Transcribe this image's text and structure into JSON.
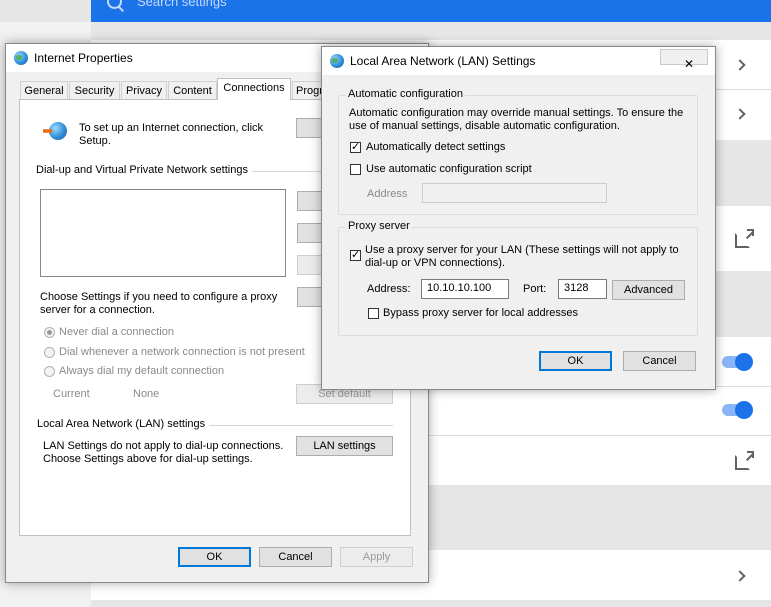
{
  "background": {
    "search_placeholder": "Search settings",
    "colors": {
      "accent": "#1a73e8",
      "toggle_track": "#8ab4f8"
    }
  },
  "internet_properties": {
    "title": "Internet Properties",
    "tabs": [
      "General",
      "Security",
      "Privacy",
      "Content",
      "Connections",
      "Progr"
    ],
    "active_tab": "Connections",
    "setup_text": "To set up an Internet connection, click Setup.",
    "dialup_group": "Dial-up and Virtual Private Network settings",
    "choose_settings_text": "Choose Settings if you need to configure a proxy server for a connection.",
    "radio_options": [
      "Never dial a connection",
      "Dial whenever a network connection is not present",
      "Always dial my default connection"
    ],
    "selected_radio": "Never dial a connection",
    "current_label": "Current",
    "current_value": "None",
    "set_default_button": "Set default",
    "lan_group": "Local Area Network (LAN) settings",
    "lan_note": "LAN Settings do not apply to dial-up connections. Choose Settings above for dial-up settings.",
    "lan_settings_button": "LAN settings",
    "buttons": {
      "ok": "OK",
      "cancel": "Cancel",
      "apply": "Apply"
    }
  },
  "lan_dialog": {
    "title": "Local Area Network (LAN) Settings",
    "auto_config_group": "Automatic configuration",
    "auto_config_desc": "Automatic configuration may override manual settings.  To ensure the use of manual settings, disable automatic configuration.",
    "auto_detect_label": "Automatically detect settings",
    "auto_detect_checked": true,
    "auto_script_label": "Use automatic configuration script",
    "auto_script_checked": false,
    "address_label": "Address",
    "address_value": "",
    "proxy_group": "Proxy server",
    "use_proxy_label": "Use a proxy server for your LAN (These settings will not apply to dial-up or VPN connections).",
    "use_proxy_checked": true,
    "proxy_address_label": "Address:",
    "proxy_address_value": "10.10.10.100",
    "port_label": "Port:",
    "port_value": "3128",
    "advanced_button": "Advanced",
    "bypass_label": "Bypass proxy server for local addresses",
    "bypass_checked": false,
    "buttons": {
      "ok": "OK",
      "cancel": "Cancel"
    }
  }
}
